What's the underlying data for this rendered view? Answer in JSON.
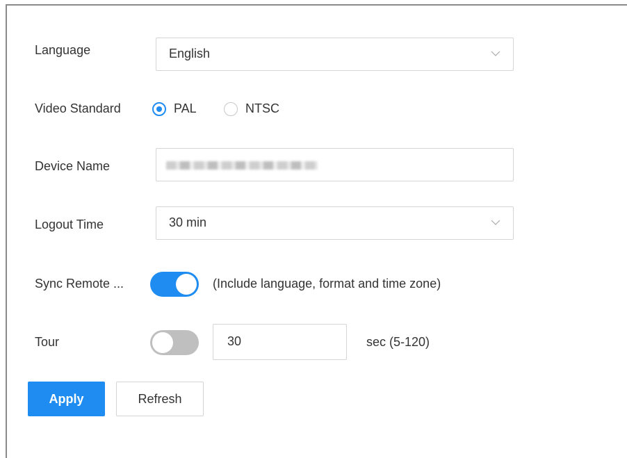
{
  "form": {
    "language": {
      "label": "Language",
      "value": "English"
    },
    "video_standard": {
      "label": "Video Standard",
      "options": [
        {
          "label": "PAL",
          "selected": true
        },
        {
          "label": "NTSC",
          "selected": false
        }
      ]
    },
    "device_name": {
      "label": "Device Name",
      "value_obscured": true
    },
    "logout_time": {
      "label": "Logout Time",
      "value": "30 min"
    },
    "sync_remote": {
      "label": "Sync Remote ...",
      "enabled": true,
      "hint": "(Include language, format and time zone)"
    },
    "tour": {
      "label": "Tour",
      "enabled": false,
      "value": "30",
      "unit_hint": "sec (5-120)"
    }
  },
  "actions": {
    "apply_label": "Apply",
    "refresh_label": "Refresh"
  },
  "colors": {
    "accent": "#1e8cf0",
    "toggle_off": "#bfbfbf",
    "border": "#d4d4d4",
    "frame": "#8a8a8a"
  },
  "icons": {
    "dropdown": "chevron-down-icon"
  }
}
